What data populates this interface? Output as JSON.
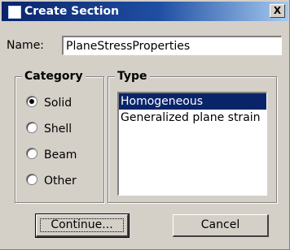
{
  "window": {
    "title": "Create Section",
    "close_glyph": "X"
  },
  "name": {
    "label": "Name:",
    "value": "PlaneStressProperties"
  },
  "category": {
    "title": "Category",
    "options": [
      {
        "label": "Solid",
        "checked": true
      },
      {
        "label": "Shell",
        "checked": false
      },
      {
        "label": "Beam",
        "checked": false
      },
      {
        "label": "Other",
        "checked": false
      }
    ]
  },
  "type": {
    "title": "Type",
    "items": [
      {
        "label": "Homogeneous",
        "selected": true
      },
      {
        "label": "Generalized plane strain",
        "selected": false
      }
    ]
  },
  "buttons": {
    "continue_label": "Continue...",
    "cancel_label": "Cancel"
  },
  "colors": {
    "dialog_face": "#d4d0c8",
    "titlebar_start": "#0a246a",
    "titlebar_end": "#a6caf0",
    "selection": "#0a246a"
  },
  "icons": {
    "app": "window-icon",
    "close": "close-icon"
  }
}
